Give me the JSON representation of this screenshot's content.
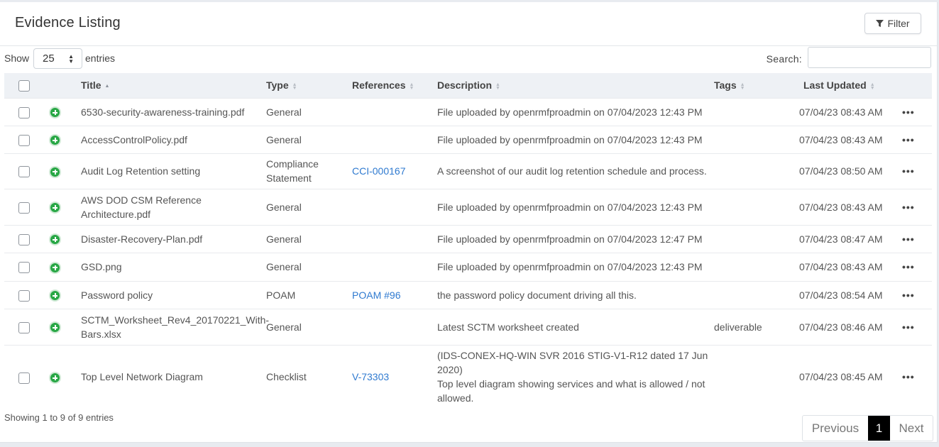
{
  "header": {
    "title": "Evidence Listing",
    "filter_label": "Filter"
  },
  "controls": {
    "show_label": "Show",
    "entries_value": "25",
    "entries_label": "entries",
    "search_label": "Search:",
    "search_value": ""
  },
  "columns": [
    "Title",
    "Type",
    "References",
    "Description",
    "Tags",
    "Last Updated"
  ],
  "rows": [
    {
      "title": "6530-security-awareness-training.pdf",
      "type": "General",
      "ref": "",
      "desc": "File uploaded by openrmfproadmin on 07/04/2023 12:43 PM",
      "tags": "",
      "updated": "07/04/23 08:43 AM"
    },
    {
      "title": "AccessControlPolicy.pdf",
      "type": "General",
      "ref": "",
      "desc": "File uploaded by openrmfproadmin on 07/04/2023 12:43 PM",
      "tags": "",
      "updated": "07/04/23 08:43 AM"
    },
    {
      "title": "Audit Log Retention setting",
      "type": "Compliance Statement",
      "ref": "CCI-000167",
      "desc": "A screenshot of our audit log retention schedule and process.",
      "tags": "",
      "updated": "07/04/23 08:50 AM"
    },
    {
      "title": "AWS DOD CSM Reference Architecture.pdf",
      "type": "General",
      "ref": "",
      "desc": "File uploaded by openrmfproadmin on 07/04/2023 12:43 PM",
      "tags": "",
      "updated": "07/04/23 08:43 AM"
    },
    {
      "title": "Disaster-Recovery-Plan.pdf",
      "type": "General",
      "ref": "",
      "desc": "File uploaded by openrmfproadmin on 07/04/2023 12:47 PM",
      "tags": "",
      "updated": "07/04/23 08:47 AM"
    },
    {
      "title": "GSD.png",
      "type": "General",
      "ref": "",
      "desc": "File uploaded by openrmfproadmin on 07/04/2023 12:43 PM",
      "tags": "",
      "updated": "07/04/23 08:43 AM"
    },
    {
      "title": "Password policy",
      "type": "POAM",
      "ref": "POAM #96",
      "desc": "the password policy document driving all this.",
      "tags": "",
      "updated": "07/04/23 08:54 AM"
    },
    {
      "title": "SCTM_Worksheet_Rev4_20170221_With-Bars.xlsx",
      "type": "General",
      "ref": "",
      "desc": "Latest SCTM worksheet created",
      "tags": "deliverable",
      "updated": "07/04/23 08:46 AM"
    },
    {
      "title": "Top Level Network Diagram",
      "type": "Checklist",
      "ref": "V-73303",
      "desc": "(IDS-CONEX-HQ-WIN SVR 2016 STIG-V1-R12 dated 17 Jun 2020)\nTop level diagram showing services and what is allowed / not allowed.",
      "tags": "",
      "updated": "07/04/23 08:45 AM"
    }
  ],
  "footer": {
    "info": "Showing 1 to 9 of 9 entries",
    "prev": "Previous",
    "page": "1",
    "next": "Next"
  },
  "colors": {
    "accent": "#2f7ad0",
    "success": "#28a745",
    "header_bg": "#eef1f5"
  }
}
